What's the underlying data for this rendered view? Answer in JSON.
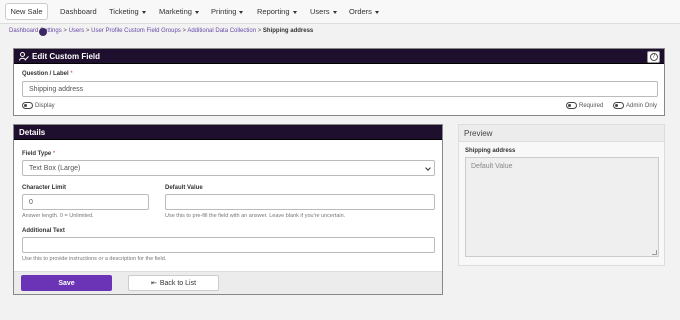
{
  "nav": {
    "new_sale": "New Sale",
    "items": [
      {
        "label": "Dashboard",
        "dropdown": false
      },
      {
        "label": "Ticketing",
        "dropdown": true
      },
      {
        "label": "Marketing",
        "dropdown": true
      },
      {
        "label": "Printing",
        "dropdown": true
      },
      {
        "label": "Reporting",
        "dropdown": true
      },
      {
        "label": "Users",
        "dropdown": true
      },
      {
        "label": "Orders",
        "dropdown": true
      }
    ]
  },
  "breadcrumb": {
    "dashboard": "Dashboard",
    "settings": "Settings",
    "users": "Users",
    "groups": "User Profile Custom Field Groups",
    "collection": "Additional Data Collection",
    "current": "Shipping address",
    "sep": ">"
  },
  "edit_panel": {
    "title": "Edit Custom Field",
    "help": "?",
    "question_label": "Question / Label",
    "required_mark": "*",
    "question_value": "Shipping address",
    "display_label": "Display",
    "required_label": "Required",
    "admin_only_label": "Admin Only"
  },
  "details": {
    "title": "Details",
    "field_type_label": "Field Type",
    "required_mark": "*",
    "field_type_value": "Text Box (Large)",
    "char_limit_label": "Character Limit",
    "char_limit_value": "0",
    "char_limit_help": "Answer length. 0 = Unlimited.",
    "default_value_label": "Default Value",
    "default_value_value": "",
    "default_value_help": "Use this to pre-fill the field with an answer. Leave blank if you're uncertain.",
    "additional_text_label": "Additional Text",
    "additional_text_value": "",
    "additional_text_help": "Use this to provide instructions or a description for the field.",
    "save": "Save",
    "back": "Back to List",
    "back_icon": "⇤"
  },
  "preview": {
    "title": "Preview",
    "field_label": "Shipping address",
    "placeholder": "Default Value"
  },
  "colors": {
    "header_bg": "#1f0f2e",
    "save_bg": "#6b34b7",
    "link": "#6a4ba8"
  }
}
